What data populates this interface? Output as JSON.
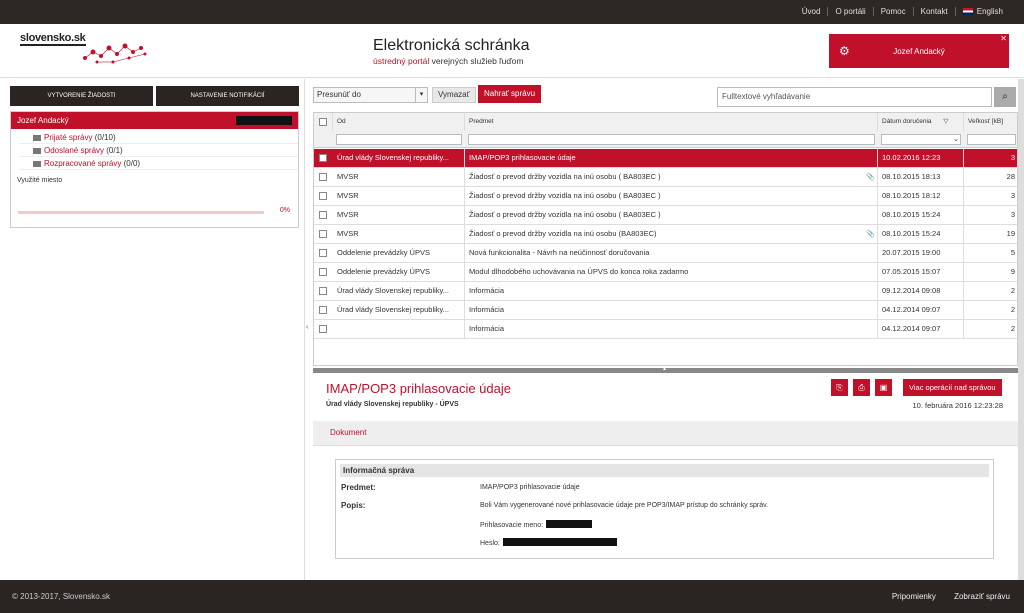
{
  "topnav": [
    "Úvod",
    "O portáli",
    "Pomoc",
    "Kontakt",
    "English"
  ],
  "logo": "slovensko.sk",
  "header": {
    "title": "Elektronická schránka",
    "subtitle_red": "ústredný portál",
    "subtitle_rest": "verejných služieb ľuďom"
  },
  "user": {
    "name": "Jozef Andacký"
  },
  "left": {
    "btn_create": "Vytvorenie žiadosti",
    "btn_notify": "Nastavenie notifikácií",
    "panel_title": "Jozef Andacký",
    "folders": [
      {
        "label": "Prijaté správy",
        "count": "(0/10)"
      },
      {
        "label": "Odoslané správy",
        "count": "(0/1)"
      },
      {
        "label": "Rozpracované správy",
        "count": "(0/0)"
      }
    ],
    "usage_label": "Využité miesto",
    "usage_pct": "0%",
    "usage_value": 0
  },
  "toolbar": {
    "move_to": "Presunúť do",
    "delete": "Vymazať",
    "upload": "Nahrať správu",
    "search_placeholder": "Fulltextové vyhľadávanie"
  },
  "columns": [
    "Od",
    "Predmet",
    "Dátum doručenia",
    "Veľkosť [kB]"
  ],
  "rows": [
    {
      "from": "Úrad vlády Slovenskej republiky...",
      "subject": "IMAP/POP3 prihlasovacie údaje",
      "date": "10.02.2016 12:23",
      "size": "3",
      "selected": true,
      "attach": false
    },
    {
      "from": "MVSR",
      "subject": "Žiadosť o prevod držby vozidla na inú osobu ( BA803EC )",
      "date": "08.10.2015 18:13",
      "size": "28",
      "selected": false,
      "attach": true
    },
    {
      "from": "MVSR",
      "subject": "Žiadosť o prevod držby vozidla na inú osobu ( BA803EC )",
      "date": "08.10.2015 18:12",
      "size": "3",
      "selected": false,
      "attach": false
    },
    {
      "from": "MVSR",
      "subject": "Žiadosť o prevod držby vozidla na inú osobu ( BA803EC )",
      "date": "08.10.2015 15:24",
      "size": "3",
      "selected": false,
      "attach": false
    },
    {
      "from": "MVSR",
      "subject": "Žiadosť o prevod držby vozidla na inú osobu (BA803EC)",
      "date": "08.10.2015 15:24",
      "size": "19",
      "selected": false,
      "attach": true
    },
    {
      "from": "Oddelenie prevádzky ÚPVS",
      "subject": "Nová funkcionalita - Návrh na neúčinnosť doručovania",
      "date": "20.07.2015 19:00",
      "size": "5",
      "selected": false,
      "attach": false
    },
    {
      "from": "Oddelenie prevádzky ÚPVS",
      "subject": "Modul dlhodobého uchovávania na ÚPVS do konca roka zadarmo",
      "date": "07.05.2015 15:07",
      "size": "9",
      "selected": false,
      "attach": false
    },
    {
      "from": "Úrad vlády Slovenskej republiky...",
      "subject": "Informácia",
      "date": "09.12.2014 09:08",
      "size": "2",
      "selected": false,
      "attach": false
    },
    {
      "from": "Úrad vlády Slovenskej republiky...",
      "subject": "Informácia",
      "date": "04.12.2014 09:07",
      "size": "2",
      "selected": false,
      "attach": false
    },
    {
      "from": "",
      "subject": "Informácia",
      "date": "04.12.2014 09:07",
      "size": "2",
      "selected": false,
      "attach": false
    }
  ],
  "detail": {
    "title": "IMAP/POP3 prihlasovacie údaje",
    "from": "Úrad vlády Slovenskej republiky - ÚPVS",
    "date": "10. februára 2016 12:23:28",
    "more_btn": "Viac operácií nad správou",
    "tab": "Dokument",
    "box_title": "Informačná správa",
    "subject_label": "Predmet:",
    "subject_value": "IMAP/POP3 prihlasovacie údaje",
    "desc_label": "Popis:",
    "desc_text": "Boli Vám vygenerované nové prihlasovacie údaje pre POP3/IMAP prístup do schránky správ.",
    "login_label": "Prihlasovacie meno:",
    "pass_label": "Heslo:"
  },
  "footer": {
    "copy": "© 2013-2017, Slovensko.sk",
    "links": [
      "Pripomienky",
      "Zobraziť správu"
    ]
  },
  "colors": {
    "accent": "#c0102a",
    "dark": "#2a2522"
  }
}
